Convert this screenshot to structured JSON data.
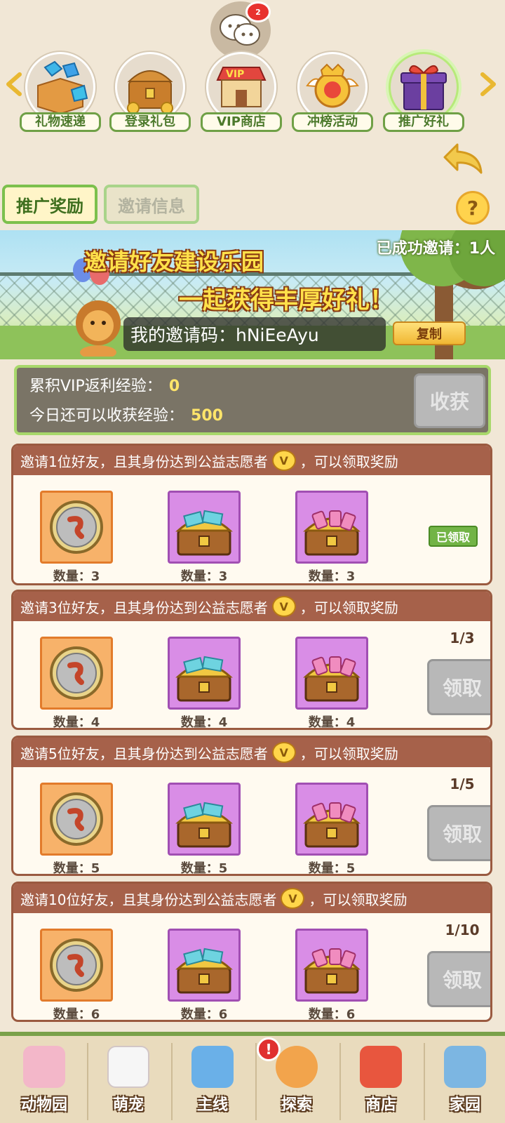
{
  "chat": {
    "badge": "2"
  },
  "top_nav": {
    "items": [
      {
        "label": "礼物速递"
      },
      {
        "label": "登录礼包"
      },
      {
        "label": "VIP商店"
      },
      {
        "label": "冲榜活动"
      },
      {
        "label": "推广好礼"
      }
    ]
  },
  "tabs": {
    "active": "推广奖励",
    "inactive": "邀请信息"
  },
  "help": {
    "symbol": "?"
  },
  "banner": {
    "success_count": "已成功邀请：1人",
    "title1": "邀请好友建设乐园",
    "title2": "一起获得丰厚好礼！",
    "invite_label": "我的邀请码：hNiEeAyu",
    "copy_label": "复制"
  },
  "vip": {
    "line1_label": "累积VIP返利经验：",
    "line1_value": "0",
    "line2_label": "今日还可以收获经验：",
    "line2_value": "500",
    "harvest_label": "收获"
  },
  "cards": [
    {
      "pre": "邀请1位好友，且其身份达到公益志愿者",
      "post": "，可以领取奖励",
      "q1": "数量：3",
      "q2": "数量：3",
      "q3": "数量：3",
      "status": "已领取"
    },
    {
      "pre": "邀请3位好友，且其身份达到公益志愿者",
      "post": "，可以领取奖励",
      "q1": "数量：4",
      "q2": "数量：4",
      "q3": "数量：4",
      "progress": "1/3",
      "button": "领取"
    },
    {
      "pre": "邀请5位好友，且其身份达到公益志愿者",
      "post": "，可以领取奖励",
      "q1": "数量：5",
      "q2": "数量：5",
      "q3": "数量：5",
      "progress": "1/5",
      "button": "领取"
    },
    {
      "pre": "邀请10位好友，且其身份达到公益志愿者",
      "post": "，可以领取奖励",
      "q1": "数量：6",
      "q2": "数量：6",
      "q3": "数量：6",
      "progress": "1/10",
      "button": "领取"
    }
  ],
  "vbadge": "V",
  "bottom_nav": {
    "alert": "!",
    "items": [
      {
        "label": "动物园"
      },
      {
        "label": "萌宠"
      },
      {
        "label": "主线"
      },
      {
        "label": "探索"
      },
      {
        "label": "商店"
      },
      {
        "label": "家园"
      }
    ]
  },
  "colors": {
    "background": "#f1e7d6",
    "card_header": "#a6614a",
    "active_tab_border": "#7cc04d",
    "disabled_button": "#b8b8b8"
  }
}
